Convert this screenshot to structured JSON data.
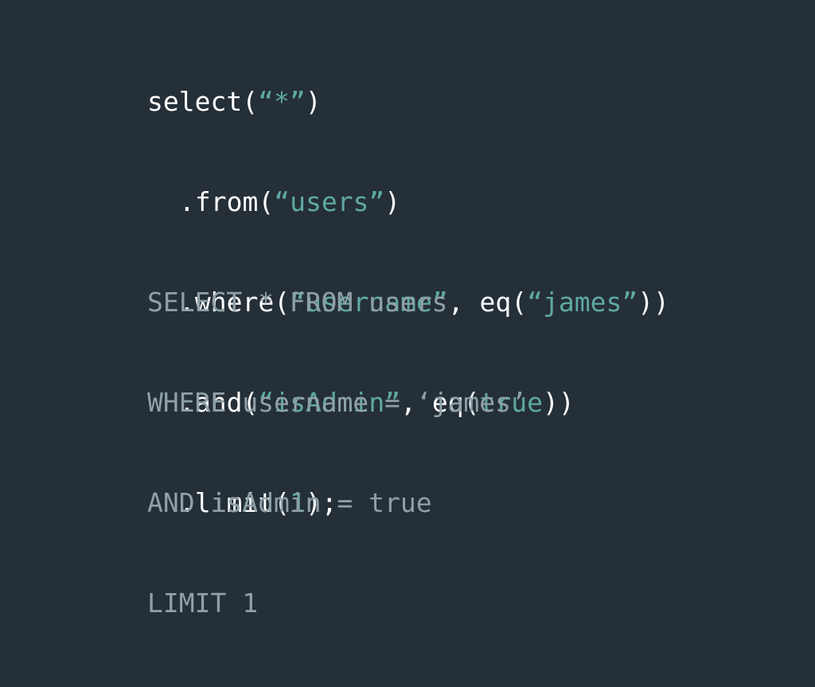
{
  "builder": {
    "lines": [
      {
        "parts": [
          {
            "t": "select(",
            "k": "plain"
          },
          {
            "t": "“*”",
            "k": "str"
          },
          {
            "t": ")",
            "k": "plain"
          }
        ]
      },
      {
        "parts": [
          {
            "t": ".from(",
            "k": "plain"
          },
          {
            "t": "“users”",
            "k": "str"
          },
          {
            "t": ")",
            "k": "plain"
          }
        ]
      },
      {
        "parts": [
          {
            "t": ".where(",
            "k": "plain"
          },
          {
            "t": "“username”",
            "k": "str"
          },
          {
            "t": ", eq(",
            "k": "plain"
          },
          {
            "t": "“james”",
            "k": "str"
          },
          {
            "t": "))",
            "k": "plain"
          }
        ]
      },
      {
        "parts": [
          {
            "t": ".and(",
            "k": "plain"
          },
          {
            "t": "“isAdmin”",
            "k": "str"
          },
          {
            "t": ", eq(",
            "k": "plain"
          },
          {
            "t": "true",
            "k": "str"
          },
          {
            "t": "))",
            "k": "plain"
          }
        ]
      },
      {
        "parts": [
          {
            "t": ".limit(",
            "k": "plain"
          },
          {
            "t": "1",
            "k": "str"
          },
          {
            "t": ");",
            "k": "plain"
          }
        ]
      }
    ]
  },
  "sql": {
    "lines": [
      "SELECT * FROM users",
      "WHERE username = ‘james’",
      "AND isAdmin = true",
      "LIMIT 1"
    ]
  },
  "colors": {
    "background": "#252f38",
    "code_text": "#ffffff",
    "string_literal": "#5fa9a4",
    "sql_text": "#8fa0a8"
  }
}
